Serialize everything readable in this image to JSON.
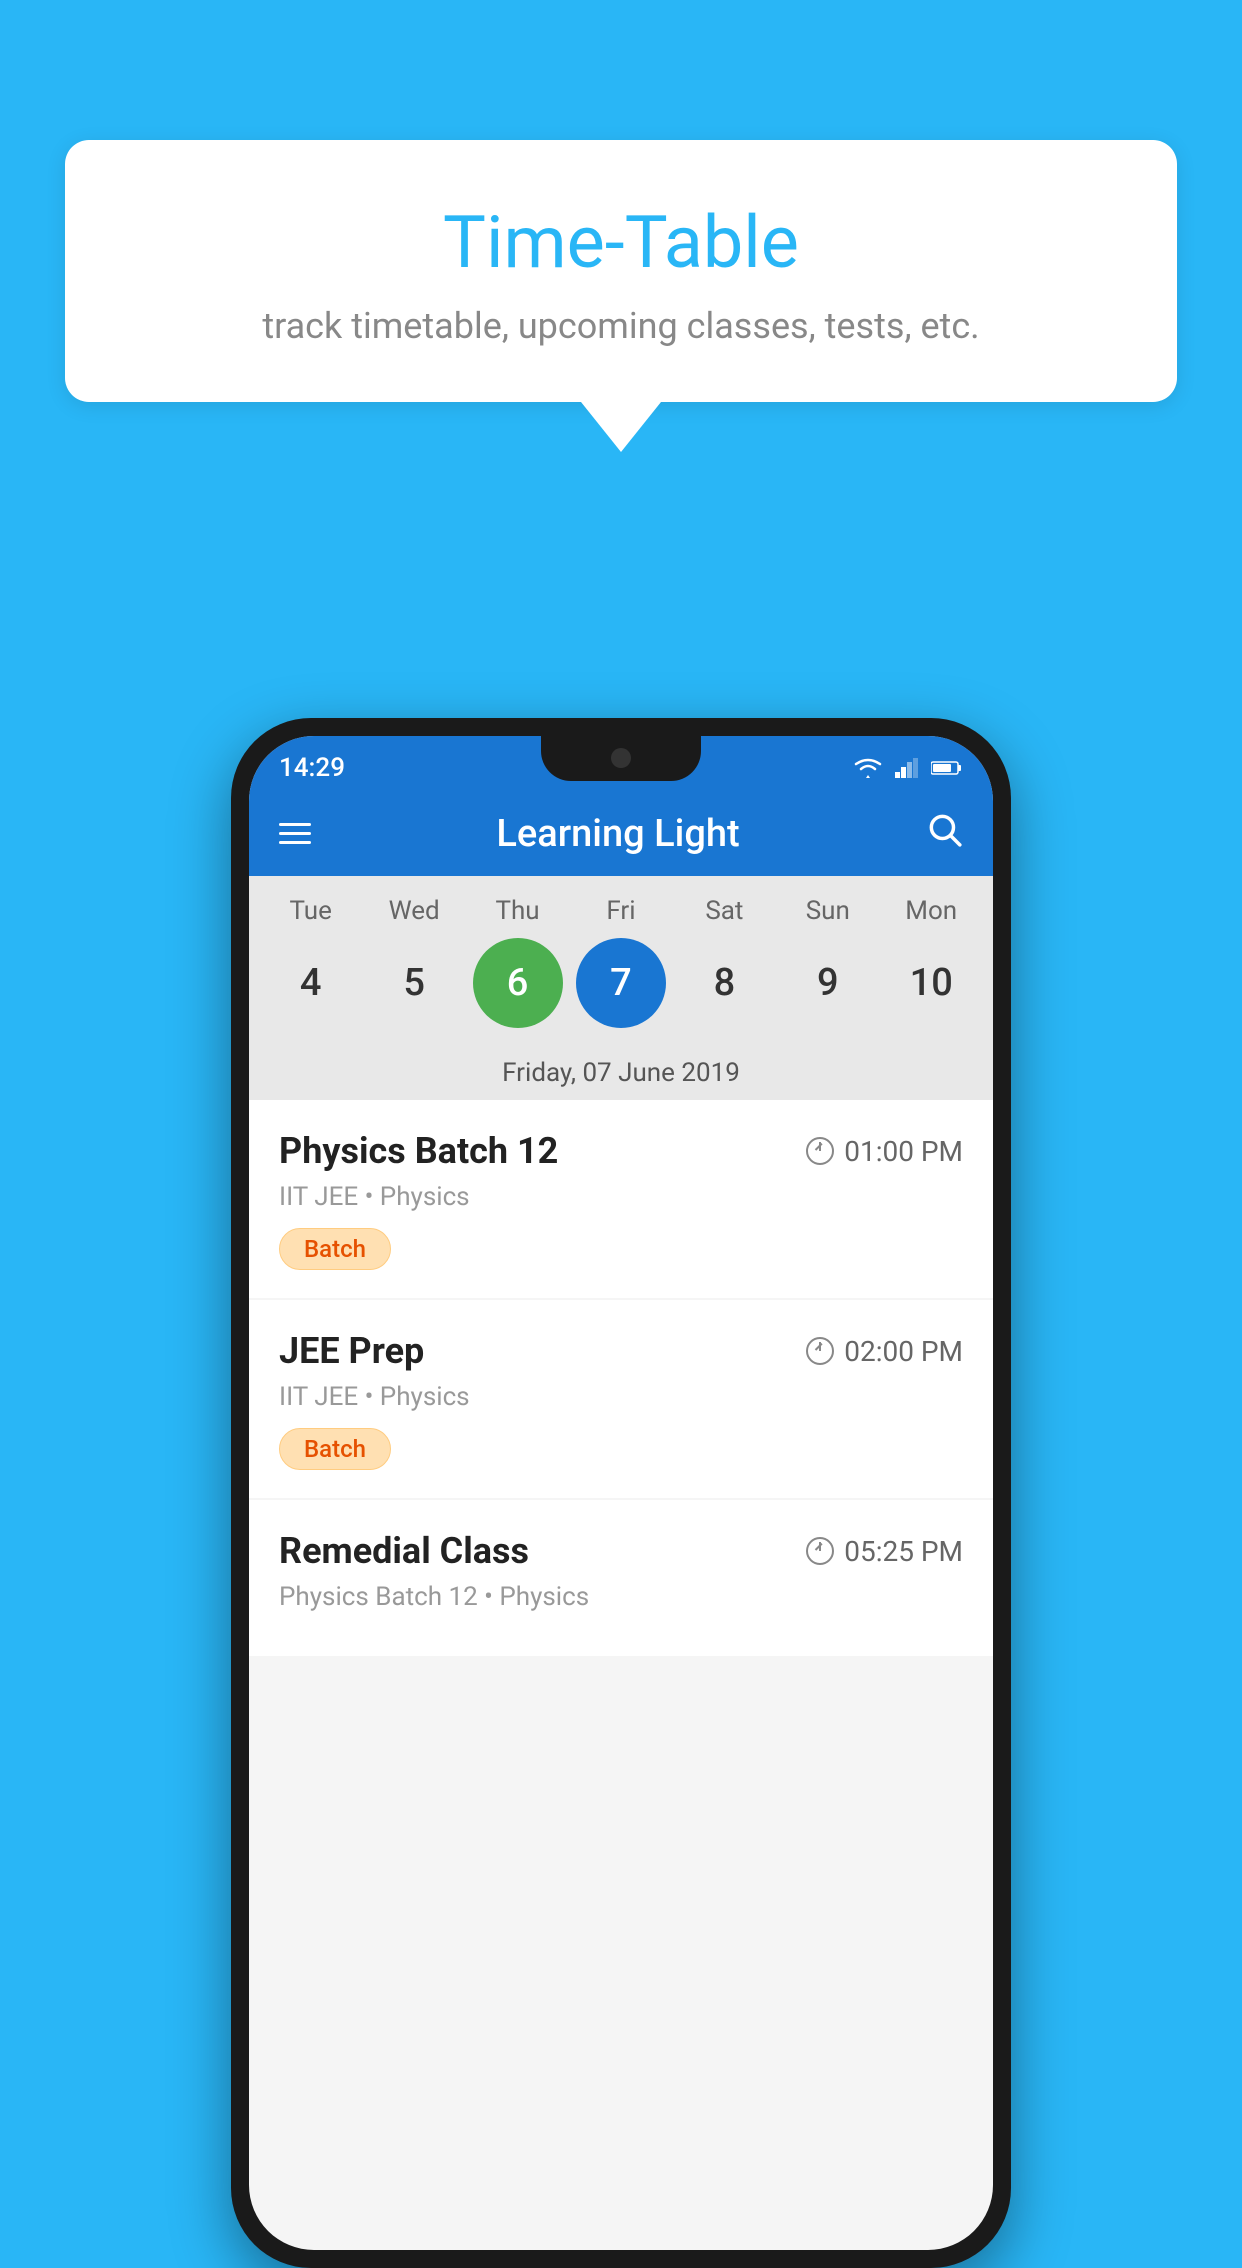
{
  "background_color": "#29B6F6",
  "speech_bubble": {
    "title": "Time-Table",
    "subtitle": "track timetable, upcoming classes, tests, etc."
  },
  "status_bar": {
    "time": "14:29"
  },
  "app_bar": {
    "title": "Learning Light"
  },
  "calendar": {
    "days": [
      {
        "label": "Tue",
        "num": "4"
      },
      {
        "label": "Wed",
        "num": "5"
      },
      {
        "label": "Thu",
        "num": "6",
        "state": "today"
      },
      {
        "label": "Fri",
        "num": "7",
        "state": "selected"
      },
      {
        "label": "Sat",
        "num": "8"
      },
      {
        "label": "Sun",
        "num": "9"
      },
      {
        "label": "Mon",
        "num": "10"
      }
    ],
    "selected_date_label": "Friday, 07 June 2019"
  },
  "schedule_items": [
    {
      "title": "Physics Batch 12",
      "time": "01:00 PM",
      "subtitle": "IIT JEE • Physics",
      "badge": "Batch"
    },
    {
      "title": "JEE Prep",
      "time": "02:00 PM",
      "subtitle": "IIT JEE • Physics",
      "badge": "Batch"
    },
    {
      "title": "Remedial Class",
      "time": "05:25 PM",
      "subtitle": "Physics Batch 12 • Physics",
      "badge": null
    }
  ]
}
